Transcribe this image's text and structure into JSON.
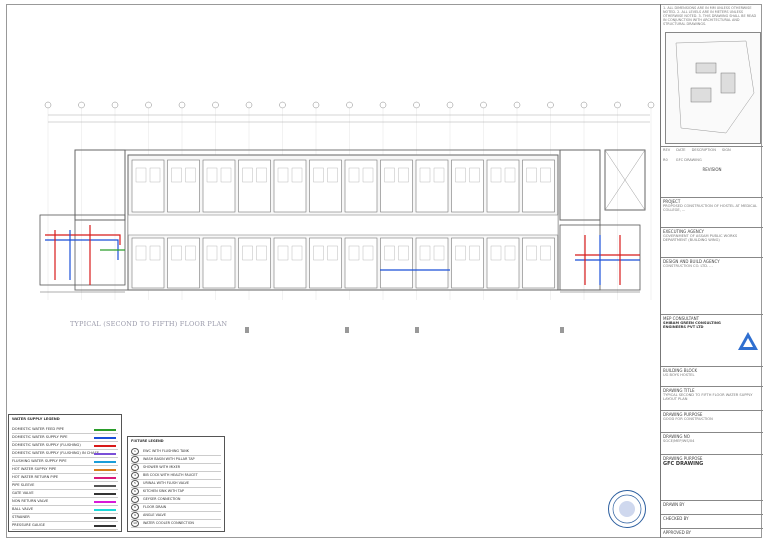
{
  "plan_title": "TYPICAL (SECOND TO FIFTH) FLOOR PLAN",
  "notes": "1. ALL DIMENSIONS ARE IN MM UNLESS OTHERWISE NOTED. 2. ALL LEVELS ARE IN METERS UNLESS OTHERWISE NOTED. 3. THIS DRAWING SHALL BE READ IN CONJUNCTION WITH ARCHITECTURAL AND STRUCTURAL DRAWINGS.",
  "revision": {
    "header": [
      "REV",
      "DATE",
      "DESCRIPTION",
      "SIGN"
    ],
    "row": [
      "R0",
      "",
      "GFC DRAWING",
      ""
    ],
    "label": "REVISION"
  },
  "title_block": {
    "project_label": "PROJECT",
    "project": "PROPOSED CONSTRUCTION OF HOSTEL AT MEDICAL COLLEGE, ...",
    "agency_label": "EXECUTING AGENCY",
    "agency": "GOVERNMENT OF ASSAM PUBLIC WORKS DEPARTMENT (BUILDING WING)",
    "design_label": "DESIGN AND BUILD AGENCY",
    "design": "CONSTRUCTION CO. LTD. ...",
    "consultant_label": "MEP CONSULTANT",
    "consultant": "SHIBAM GREEN CONSULTING ENGINEERS PVT LTD",
    "building_label": "BUILDING BLOCK",
    "building": "UG BOYS HOSTEL",
    "title_label": "DRAWING TITLE",
    "title": "TYPICAL SECOND TO FIFTH FLOOR WATER SUPPLY LAYOUT PLAN",
    "purpose_label": "DRAWING PURPOSE",
    "purpose": "GOOD FOR CONSTRUCTION",
    "no_label": "DRAWING NO",
    "no": "SGCE/MEP/WS/04",
    "stage_label": "DRAWING PURPOSE",
    "stage": "GFC DRAWING",
    "drawn_label": "DRAWN BY",
    "checked_label": "CHECKED BY",
    "approved_label": "APPROVED BY"
  },
  "legend": {
    "title": "WATER SUPPLY LEGEND",
    "rows": [
      {
        "text": "DOMESTIC WATER FEED PIPE",
        "color": "#2a9d2a"
      },
      {
        "text": "DOMESTIC WATER SUPPLY PIPE",
        "color": "#1a4fd8"
      },
      {
        "text": "DOMESTIC WATER SUPPLY (FLUSHING)",
        "color": "#d81a1a"
      },
      {
        "text": "DOMESTIC WATER SUPPLY (FLUSHING) IN CHASE",
        "color": "#7a4fd8"
      },
      {
        "text": "FLUSHING WATER SUPPLY PIPE",
        "color": "#1a9dd8"
      },
      {
        "text": "HOT WATER SUPPLY PIPE",
        "color": "#d87a1a"
      },
      {
        "text": "HOT WATER RETURN PIPE",
        "color": "#d81a7a"
      },
      {
        "text": "PIPE SLEEVE",
        "color": "#555555"
      },
      {
        "text": "GATE VALVE",
        "color": "#333333"
      },
      {
        "text": "NON RETURN VALVE",
        "color": "#d81ad8"
      },
      {
        "text": "BALL VALVE",
        "color": "#1ad8d8"
      },
      {
        "text": "STRAINER",
        "color": "#333333"
      },
      {
        "text": "PRESSURE GAUGE",
        "color": "#333333"
      }
    ]
  },
  "fixture_legend": {
    "title": "FIXTURE LEGEND",
    "rows": [
      {
        "n": "1",
        "text": "EWC WITH FLUSHING TANK"
      },
      {
        "n": "2",
        "text": "WASH BASIN WITH PILLAR TAP"
      },
      {
        "n": "3",
        "text": "SHOWER WITH MIXER"
      },
      {
        "n": "4",
        "text": "BIB COCK WITH HEALTH FAUCET"
      },
      {
        "n": "5",
        "text": "URINAL WITH FLUSH VALVE"
      },
      {
        "n": "6",
        "text": "KITCHEN SINK WITH TAP"
      },
      {
        "n": "7",
        "text": "GEYSER CONNECTION"
      },
      {
        "n": "8",
        "text": "FLOOR DRAIN"
      },
      {
        "n": "9",
        "text": "ANGLE VALVE"
      },
      {
        "n": "10",
        "text": "WATER COOLER CONNECTION"
      }
    ]
  },
  "colors": {
    "plan_line": "#8a8a8a",
    "feed": "#1a4fd8",
    "supply": "#d81a1a",
    "flush": "#2a9d2a"
  }
}
